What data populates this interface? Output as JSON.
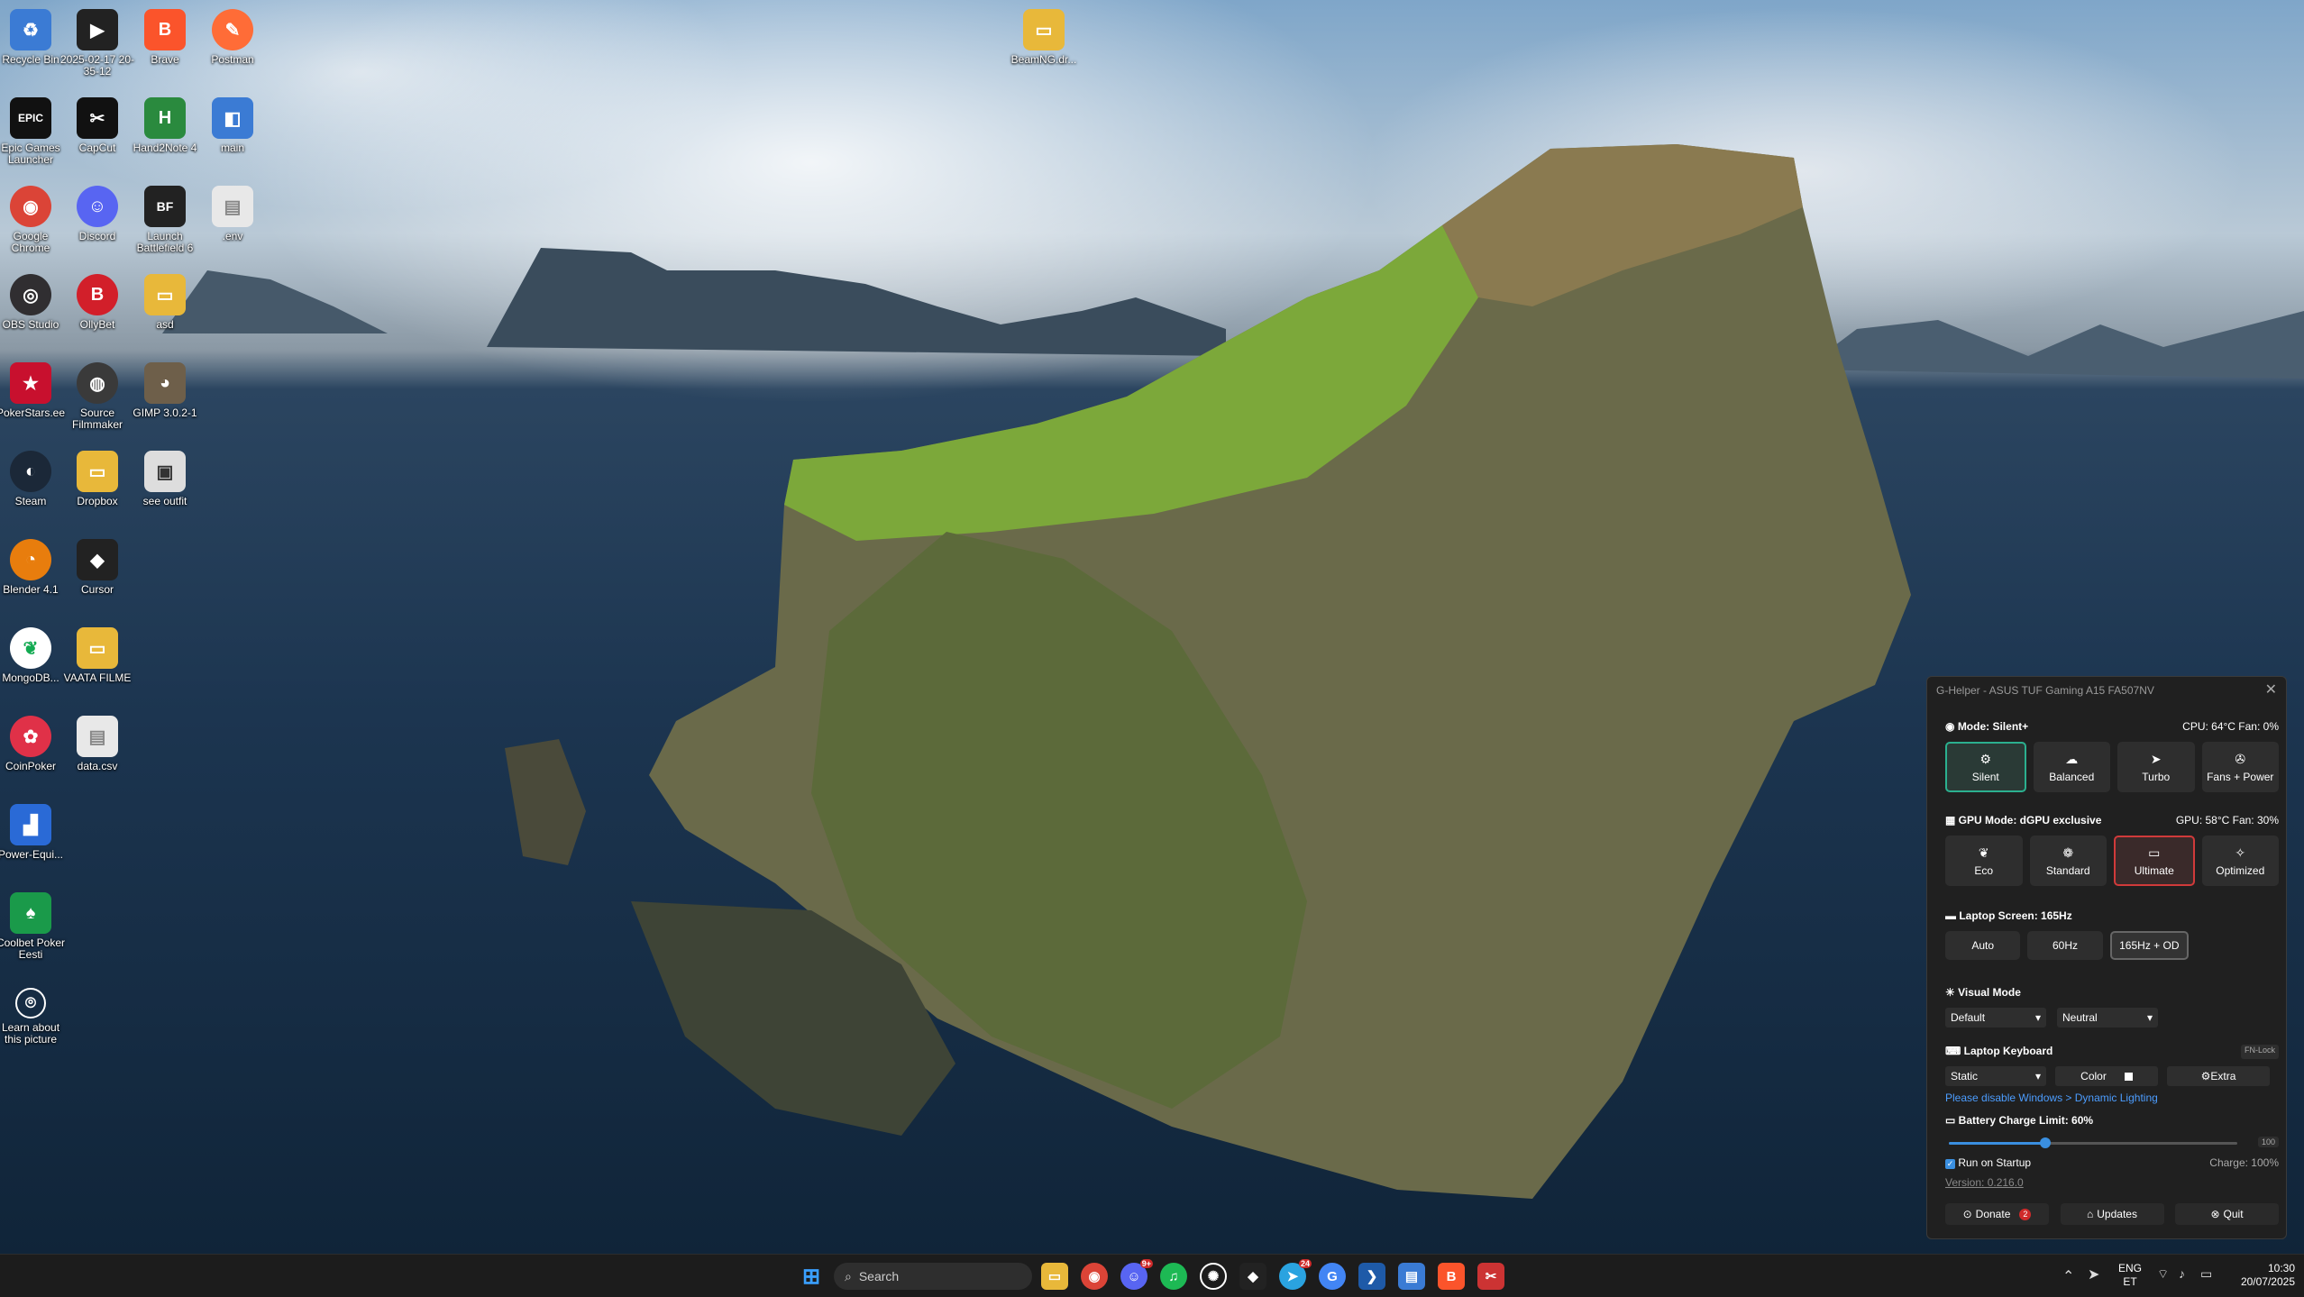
{
  "desktop": {
    "icons": [
      {
        "label": "Recycle Bin",
        "glyph": "♻",
        "color": "#3b7bd4"
      },
      {
        "label": "2025-02-17 20-35-12",
        "glyph": "▶",
        "color": "#222222"
      },
      {
        "label": "Brave",
        "glyph": "B",
        "color": "#fb542b"
      },
      {
        "label": "Postman",
        "glyph": "✎",
        "color": "#ff6c37"
      },
      {
        "label": "Epic Games Launcher",
        "glyph": "EPIC",
        "color": "#111111"
      },
      {
        "label": "CapCut",
        "glyph": "✂",
        "color": "#111111"
      },
      {
        "label": "Hand2Note 4",
        "glyph": "H",
        "color": "#2a8a3e"
      },
      {
        "label": "main",
        "glyph": "◧",
        "color": "#3b7bd4"
      },
      {
        "label": "Google Chrome",
        "glyph": "◉",
        "color": "#db4437"
      },
      {
        "label": "Discord",
        "glyph": "☺",
        "color": "#5865f2"
      },
      {
        "label": "Launch Battlefield 6",
        "glyph": "BF",
        "color": "#222222"
      },
      {
        "label": ".env",
        "glyph": "▤",
        "color": "#e8e8e8"
      },
      {
        "label": "OBS Studio",
        "glyph": "◎",
        "color": "#302e31"
      },
      {
        "label": "OllyBet",
        "glyph": "B",
        "color": "#d21f2a"
      },
      {
        "label": "asd",
        "glyph": "▭",
        "color": "#e8b83a"
      },
      {
        "label": "PokerStars.ee",
        "glyph": "★",
        "color": "#c8102e"
      },
      {
        "label": "Source Filmmaker",
        "glyph": "◍",
        "color": "#3a3a3a"
      },
      {
        "label": "GIMP 3.0.2-1",
        "glyph": "◕",
        "color": "#6e5f4a"
      },
      {
        "label": "Steam",
        "glyph": "◐",
        "color": "#1b2838"
      },
      {
        "label": "Dropbox",
        "glyph": "▭",
        "color": "#e8b83a"
      },
      {
        "label": "see outfit",
        "glyph": "▣",
        "color": "#dddddd"
      },
      {
        "label": "Blender 4.1",
        "glyph": "◔",
        "color": "#e87d0d"
      },
      {
        "label": "Cursor",
        "glyph": "◆",
        "color": "#222222"
      },
      {
        "label": "MongoDB...",
        "glyph": "❦",
        "color": "#13aa52"
      },
      {
        "label": "VAATA FILME",
        "glyph": "▭",
        "color": "#e8b83a"
      },
      {
        "label": "CoinPoker",
        "glyph": "✿",
        "color": "#e03148"
      },
      {
        "label": "data.csv",
        "glyph": "▤",
        "color": "#e8e8e8"
      },
      {
        "label": "Power-Equi...",
        "glyph": "▟",
        "color": "#2a6ad6"
      },
      {
        "label": "Coolbet Poker Eesti",
        "glyph": "♠",
        "color": "#1a9a4a"
      },
      {
        "label": "Learn about this picture",
        "glyph": "⌾",
        "color": "#444444"
      },
      {
        "label": "BeamNG.dr...",
        "glyph": "▭",
        "color": "#e8b83a"
      }
    ]
  },
  "ghelper": {
    "title": "G-Helper - ASUS TUF Gaming A15 FA507NV",
    "mode": {
      "label": "Mode: Silent+",
      "status": "CPU: 64°C Fan: 0%",
      "buttons": [
        {
          "label": "Silent",
          "glyph": "⚙"
        },
        {
          "label": "Balanced",
          "glyph": "☁"
        },
        {
          "label": "Turbo",
          "glyph": "➤"
        },
        {
          "label": "Fans + Power",
          "glyph": "✇"
        }
      ]
    },
    "gpu": {
      "label": "GPU Mode: dGPU exclusive",
      "status": "GPU: 58°C Fan: 30%",
      "buttons": [
        {
          "label": "Eco",
          "glyph": "❦"
        },
        {
          "label": "Standard",
          "glyph": "❁"
        },
        {
          "label": "Ultimate",
          "glyph": "▭"
        },
        {
          "label": "Optimized",
          "glyph": "✧"
        }
      ]
    },
    "screen": {
      "label": "Laptop Screen: 165Hz",
      "buttons": [
        "Auto",
        "60Hz",
        "165Hz + OD"
      ]
    },
    "visual": {
      "label": "Visual Mode",
      "mode": "Default",
      "color": "Neutral"
    },
    "keyboard": {
      "label": "Laptop Keyboard",
      "fnlock": "FN-Lock",
      "mode": "Static",
      "color_label": "Color",
      "extra_label": "Extra",
      "warning": "Please disable Windows > Dynamic Lighting"
    },
    "battery": {
      "label": "Battery Charge Limit: 60%",
      "max_label": "100",
      "limit_percent": 60
    },
    "startup": {
      "label": "Run on Startup",
      "charge": "Charge: 100%"
    },
    "version": "Version: 0.216.0",
    "footer": {
      "donate": "Donate",
      "donate_badge": "2",
      "updates": "Updates",
      "quit": "Quit"
    }
  },
  "taskbar": {
    "search_placeholder": "Search",
    "discord_badge": "9+",
    "telegram_badge": "24",
    "lang": "ENG",
    "region": "ET",
    "time": "10:30",
    "date": "20/07/2025"
  }
}
